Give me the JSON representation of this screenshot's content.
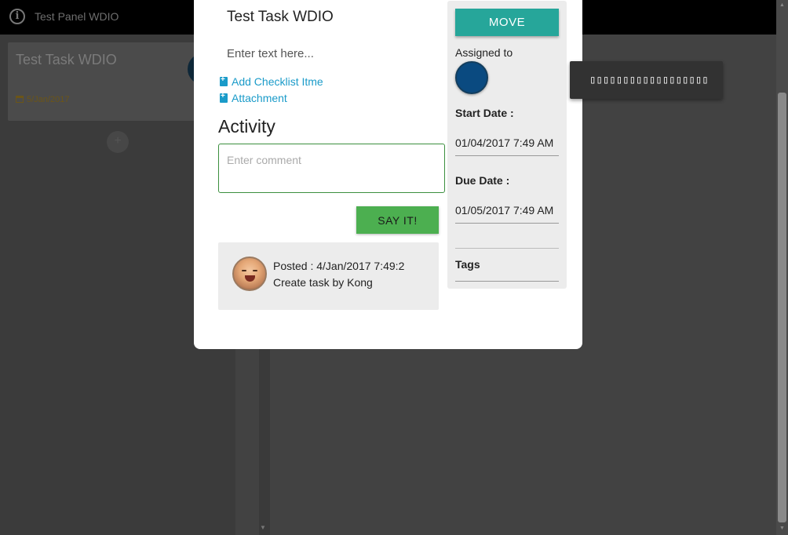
{
  "board": {
    "title": "Test Panel WDIO",
    "info_icon": "info-icon",
    "card": {
      "title": "Test Task WDIO",
      "date": "5/Jan/2017",
      "date_icon": "calendar-icon"
    },
    "add_icon": "+"
  },
  "modal": {
    "title": "Test Task WDIO",
    "description_placeholder": "Enter text here...",
    "add_checklist_label": "Add Checklist Itme",
    "attachment_label": "Attachment",
    "activity_heading": "Activity",
    "comment_placeholder": "Enter comment",
    "say_button_label": "SAY IT!",
    "post": {
      "posted": "Posted : 4/Jan/2017 7:49:2",
      "message": "Create task by Kong"
    },
    "side": {
      "move_label": "MOVE",
      "assigned_label": "Assigned to",
      "start_label": "Start Date :",
      "start_value": "01/04/2017 7:49 AM",
      "due_label": "Due Date :",
      "due_value": "01/05/2017 7:49 AM",
      "tags_label": "Tags"
    }
  },
  "tooltip": {
    "text": "▯▯▯▯▯▯▯▯▯▯▯▯▯▯▯▯▯▯"
  },
  "colors": {
    "accent_teal": "#26a69a",
    "say_green": "#4caf50",
    "link_blue": "#1a9bc9",
    "assignee_blue": "#0a4a80"
  }
}
